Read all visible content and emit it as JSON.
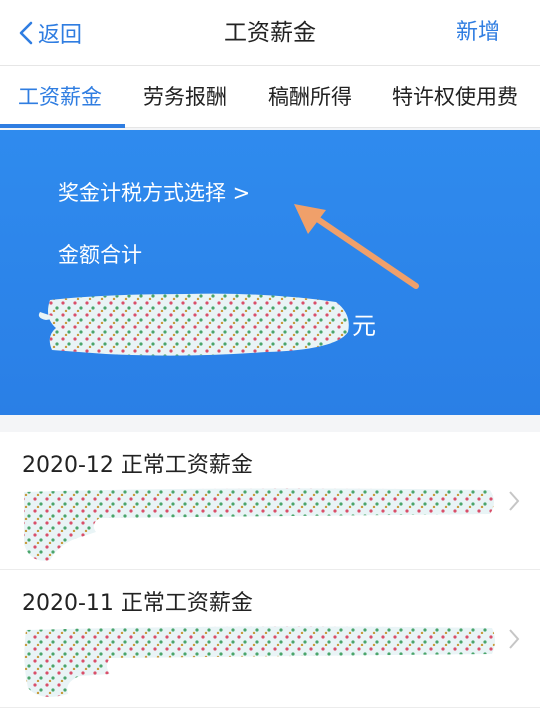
{
  "header": {
    "back_label": "返回",
    "title": "工资薪金",
    "add_label": "新增"
  },
  "tabs": [
    {
      "label": "工资薪金",
      "active": true
    },
    {
      "label": "劳务报酬",
      "active": false
    },
    {
      "label": "稿酬所得",
      "active": false
    },
    {
      "label": "特许权使用费",
      "active": false
    }
  ],
  "banner": {
    "tax_method_label": "奖金计税方式选择 >",
    "total_label": "金额合计",
    "amount_unit": "元"
  },
  "records": [
    {
      "title": "2020-12 正常工资薪金"
    },
    {
      "title": "2020-11 正常工资薪金"
    }
  ],
  "colors": {
    "accent": "#2f7de1",
    "banner": "#2a7fe6",
    "arrow": "#f0a06a"
  },
  "icons": {
    "back": "chevron-left-icon",
    "row": "chevron-right-icon"
  }
}
